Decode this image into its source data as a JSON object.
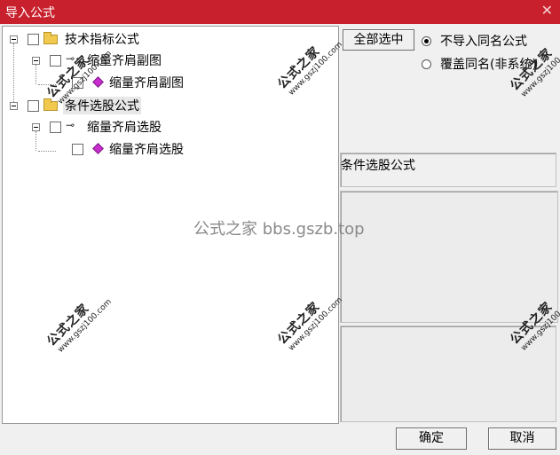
{
  "window": {
    "title": "导入公式",
    "close_glyph": "✕"
  },
  "tree": {
    "nodes": [
      {
        "label": "技术指标公式"
      },
      {
        "label": "缩量齐肩副图"
      },
      {
        "label": "缩量齐肩副图"
      },
      {
        "label": "条件选股公式"
      },
      {
        "label": "缩量齐肩选股"
      },
      {
        "label": "缩量齐肩选股"
      }
    ]
  },
  "right": {
    "select_all_label": "全部选中",
    "radio_skip_label": "不导入同名公式",
    "radio_overwrite_label": "覆盖同名(非系统)",
    "description_title": "条件选股公式"
  },
  "buttons": {
    "ok": "确定",
    "cancel": "取消"
  },
  "watermark": {
    "center": "公式之家 bbs.gszb.top",
    "stamp_cn": "公式之家",
    "stamp_url": "www.gszj100.com"
  }
}
